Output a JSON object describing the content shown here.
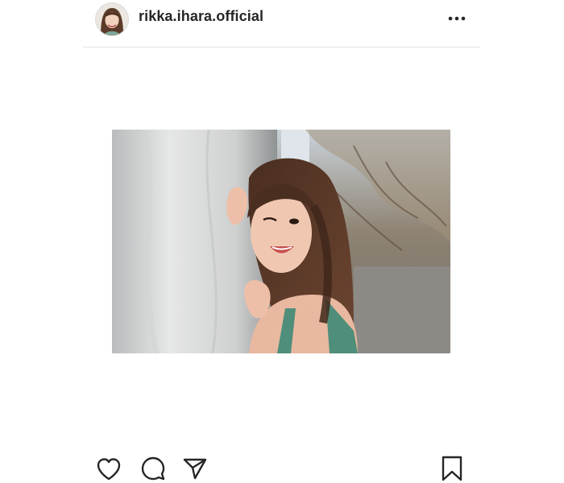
{
  "post": {
    "username": "rikka.ihara.official"
  },
  "icons": {
    "more": "more-options-icon",
    "like": "heart-icon",
    "comment": "comment-bubble-icon",
    "share": "paper-plane-icon",
    "save": "bookmark-icon"
  },
  "colors": {
    "text": "#262626",
    "divider": "#e6e6e6",
    "icon": "#262626"
  }
}
